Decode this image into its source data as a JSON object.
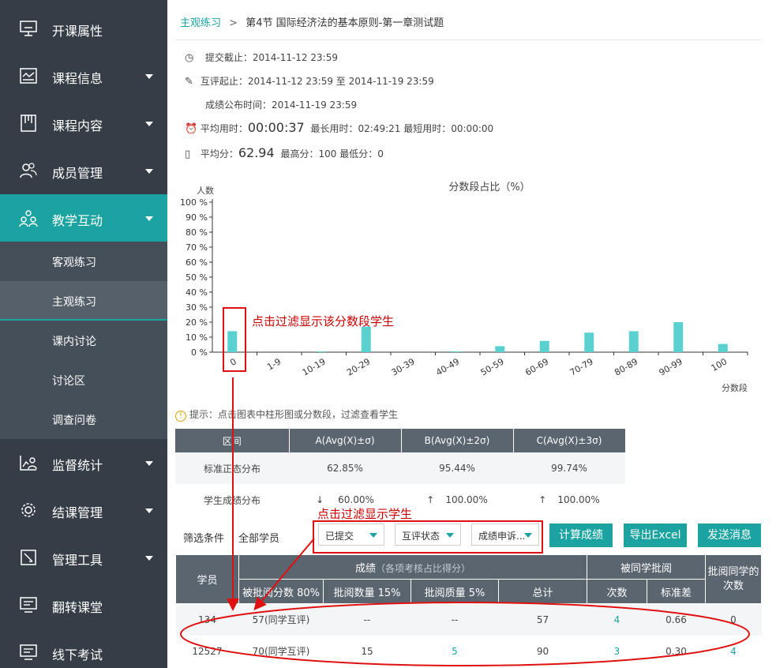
{
  "sidebar": {
    "items": [
      {
        "label": "开课属性",
        "icon": "podium-icon",
        "caret": false
      },
      {
        "label": "课程信息",
        "icon": "info-card-icon",
        "caret": true
      },
      {
        "label": "课程内容",
        "icon": "book-icon",
        "caret": true
      },
      {
        "label": "成员管理",
        "icon": "members-icon",
        "caret": true
      },
      {
        "label": "教学互动",
        "icon": "interaction-icon",
        "caret": true,
        "active": true
      },
      {
        "label": "监督统计",
        "icon": "stats-icon",
        "caret": true
      },
      {
        "label": "结课管理",
        "icon": "gear-icon",
        "caret": true
      },
      {
        "label": "管理工具",
        "icon": "tools-icon",
        "caret": true
      },
      {
        "label": "翻转课堂",
        "icon": "screen-icon",
        "caret": false
      },
      {
        "label": "线下考试",
        "icon": "exam-screen-icon",
        "caret": false
      }
    ],
    "subitems": [
      {
        "label": "客观练习"
      },
      {
        "label": "主观练习",
        "selected": true
      },
      {
        "label": "课内讨论"
      },
      {
        "label": "讨论区"
      },
      {
        "label": "调查问卷"
      }
    ]
  },
  "breadcrumb": {
    "link": "主观练习",
    "separator": ">",
    "current": "第4节 国际经济法的基本原则-第一章测试题"
  },
  "info": {
    "submit_deadline": "提交截止：2014-11-12 23:59",
    "review_period": "互评起止：2014-11-12 23:59 至 2014-11-19 23:59",
    "publish_time": "成绩公布时间：2014-11-19 23:59",
    "avg_time_label": "平均用时：",
    "avg_time_value": "00:00:37",
    "time_extra": "最长用时：02:49:21 最短用时：00:00:00",
    "avg_score_label": "平均分：",
    "avg_score_value": "62.94",
    "score_extra": "最高分：100 最低分：0"
  },
  "chart_data": {
    "type": "bar",
    "title": "分数段占比（%）",
    "ylabel": "人数",
    "xlabel": "分数段",
    "categories": [
      "0",
      "1-9",
      "10-19",
      "20-29",
      "30-39",
      "40-49",
      "50-59",
      "60-69",
      "70-79",
      "80-89",
      "90-99",
      "100"
    ],
    "values": [
      14,
      0,
      0.5,
      17,
      0,
      0.5,
      4,
      7.5,
      13,
      14,
      20,
      5.5
    ],
    "yticks": [
      "0 %",
      "10 %",
      "20 %",
      "30 %",
      "40 %",
      "50 %",
      "60 %",
      "70 %",
      "80 %",
      "90 %",
      "100 %"
    ],
    "ylim": [
      0,
      100
    ],
    "color": "#5bd0d0"
  },
  "hint": "提示：点击图表中柱形图或分数段，过滤查看学生",
  "dist_table": {
    "headers": [
      "区间",
      "A(Avg(X)±σ)",
      "B(Avg(X)±2σ)",
      "C(Avg(X)±3σ)"
    ],
    "rows": [
      {
        "label": "标准正态分布",
        "a": "62.85%",
        "b": "95.44%",
        "c": "99.74%"
      },
      {
        "label": "学生成绩分布",
        "a_arrow": "↓",
        "a": "60.00%",
        "b_arrow": "↑",
        "b": "100.00%",
        "c_arrow": "↑",
        "c": "100.00%"
      }
    ]
  },
  "annotations": {
    "bar_note": "点击过滤显示该分数段学生",
    "filter_note": "点击过滤显示学生"
  },
  "filters": {
    "label": "筛选条件",
    "scope": "全部学员",
    "submitted": "已提交",
    "review_status": "互评状态",
    "appeal": "成绩申诉..."
  },
  "buttons": {
    "calc": "计算成绩",
    "export": "导出Excel",
    "message": "发送消息"
  },
  "score_table": {
    "student": "学员",
    "score_group": "成绩",
    "score_group_note": "（各项考核占比得分）",
    "reviewed_group": "被同学批阅",
    "review_others": "批阅同学的次数",
    "sub_headers": [
      "被批阅分数 80%",
      "批阅数量 15%",
      "批阅质量 5%",
      "总计",
      "次数",
      "标准差"
    ],
    "rows": [
      {
        "student": "134",
        "reviewed_score": "57(同学互评)",
        "review_count": "--",
        "review_quality": "--",
        "total": "57",
        "times": "4",
        "stddev": "0.66",
        "review_others": "0"
      },
      {
        "student": "12527",
        "reviewed_score": "70(同学互评)",
        "review_count": "15",
        "review_quality": "5",
        "total": "90",
        "times": "3",
        "stddev": "0.30",
        "review_others": "4"
      }
    ]
  },
  "colors": {
    "accent": "#1aa3a0",
    "sidebar": "#353e47",
    "annotation": "#cc0000",
    "table_header": "#5a6570"
  }
}
